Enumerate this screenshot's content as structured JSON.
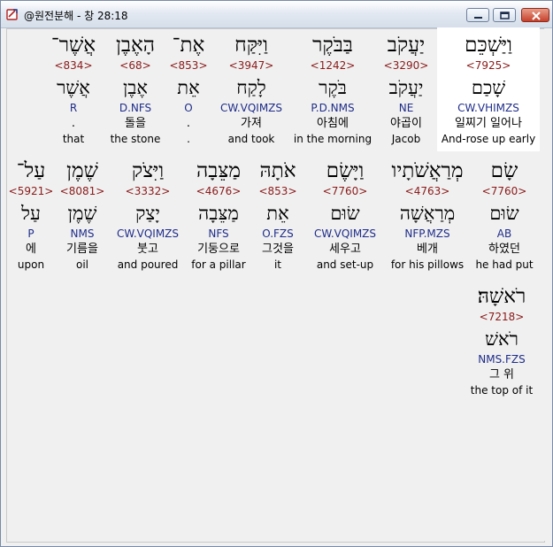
{
  "window": {
    "title": "@원전분해 - 창 28:18"
  },
  "colors": {
    "strong": "#8b1a1a",
    "parsing": "#1f2d8a",
    "selected_bg": "#ffffff"
  },
  "icons": {
    "app": "bible-app-icon",
    "minimize": "minimize-icon",
    "maximize": "maximize-icon",
    "close": "close-icon"
  },
  "words": [
    {
      "hebrew": "וַיַּשְׁכֵּם",
      "strong": "<7925>",
      "lexeme": "שָׁכַם",
      "parsing": "CW.VHIMZS",
      "korean": "일찌기 일어나",
      "english": "And-rose up early",
      "selected": true
    },
    {
      "hebrew": "יַעֲקֹב",
      "strong": "<3290>",
      "lexeme": "יַעֲקֹב",
      "parsing": "NE",
      "korean": "야곱이",
      "english": "Jacob"
    },
    {
      "hebrew": "בַּבֹּקֶר",
      "strong": "<1242>",
      "lexeme": "בֹּקֶר",
      "parsing": "P.D.NMS",
      "korean": "아침에",
      "english": "in the morning"
    },
    {
      "hebrew": "וַיִּקַּח",
      "strong": "<3947>",
      "lexeme": "לָקַח",
      "parsing": "CW.VQIMZS",
      "korean": "가져",
      "english": "and took"
    },
    {
      "hebrew": "אֶת־",
      "strong": "<853>",
      "lexeme": "אֵת",
      "parsing": "O",
      "korean": ".",
      "english": "."
    },
    {
      "hebrew": "הָאֶבֶן",
      "strong": "<68>",
      "lexeme": "אֶבֶן",
      "parsing": "D.NFS",
      "korean": "돌을",
      "english": "the stone"
    },
    {
      "hebrew": "אֲשֶׁר־",
      "strong": "<834>",
      "lexeme": "אֲשֶׁר",
      "parsing": "R",
      "korean": ".",
      "english": "that"
    },
    {
      "hebrew": "שָׂם",
      "strong": "<7760>",
      "lexeme": "שׂוּם",
      "parsing": "AB",
      "korean": "하였던",
      "english": "he had put"
    },
    {
      "hebrew": "מְרַאֲשֹׁתָיו",
      "strong": "<4763>",
      "lexeme": "מְרַאֲשָׁה",
      "parsing": "NFP.MZS",
      "korean": "베개",
      "english": "for his pillows"
    },
    {
      "hebrew": "וַיָּשֶׂם",
      "strong": "<7760>",
      "lexeme": "שׂוּם",
      "parsing": "CW.VQIMZS",
      "korean": "세우고",
      "english": "and set-up"
    },
    {
      "hebrew": "אֹתָהּ",
      "strong": "<853>",
      "lexeme": "אֵת",
      "parsing": "O.FZS",
      "korean": "그것을",
      "english": "it"
    },
    {
      "hebrew": "מַצֵּבָה",
      "strong": "<4676>",
      "lexeme": "מַצֵּבָה",
      "parsing": "NFS",
      "korean": "기둥으로",
      "english": "for a pillar"
    },
    {
      "hebrew": "וַיִּצֹק",
      "strong": "<3332>",
      "lexeme": "יָצַק",
      "parsing": "CW.VQIMZS",
      "korean": "붓고",
      "english": "and poured"
    },
    {
      "hebrew": "שֶׁמֶן",
      "strong": "<8081>",
      "lexeme": "שֶׁמֶן",
      "parsing": "NMS",
      "korean": "기름을",
      "english": "oil"
    },
    {
      "hebrew": "עַל־",
      "strong": "<5921>",
      "lexeme": "עַל",
      "parsing": "P",
      "korean": "에",
      "english": "upon"
    },
    {
      "hebrew": "רֹאשָׁהּ׃",
      "strong": "<7218>",
      "lexeme": "רֹאשׁ",
      "parsing": "NMS.FZS",
      "korean": "그 위",
      "english": "the top of it"
    }
  ]
}
